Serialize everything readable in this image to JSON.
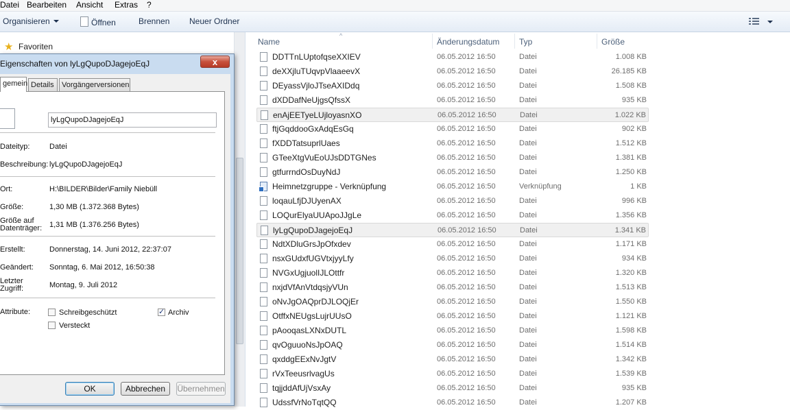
{
  "menubar": {
    "items": [
      "Datei",
      "Bearbeiten",
      "Ansicht",
      "Extras",
      "?"
    ]
  },
  "toolbar": {
    "organize": "Organisieren",
    "open": "Öffnen",
    "burn": "Brennen",
    "new_folder": "Neuer Ordner"
  },
  "nav": {
    "favorites": "Favoriten"
  },
  "columns": {
    "name": "Name",
    "date": "Änderungsdatum",
    "type": "Typ",
    "size": "Größe"
  },
  "files": [
    {
      "name": "DDTTnLUptofqseXXIEV",
      "date": "06.05.2012 16:50",
      "type": "Datei",
      "size": "1.008 KB"
    },
    {
      "name": "deXXjluTUqvpVlaaeevX",
      "date": "06.05.2012 16:50",
      "type": "Datei",
      "size": "26.185 KB"
    },
    {
      "name": "DEyassVjloJTseAXIDdq",
      "date": "06.05.2012 16:50",
      "type": "Datei",
      "size": "1.508 KB"
    },
    {
      "name": "dXDDafNeUjgsQfssX",
      "date": "06.05.2012 16:50",
      "type": "Datei",
      "size": "935 KB"
    },
    {
      "name": "enAjEETyeLUjloyasnXO",
      "date": "06.05.2012 16:50",
      "type": "Datei",
      "size": "1.022 KB"
    },
    {
      "name": "ftjGqddooGxAdqEsGq",
      "date": "06.05.2012 16:50",
      "type": "Datei",
      "size": "902 KB"
    },
    {
      "name": "fXDDTatsuprlUaes",
      "date": "06.05.2012 16:50",
      "type": "Datei",
      "size": "1.512 KB"
    },
    {
      "name": "GTeeXtgVuEoUJsDDTGNes",
      "date": "06.05.2012 16:50",
      "type": "Datei",
      "size": "1.381 KB"
    },
    {
      "name": "gtfurrndOsDuyNdJ",
      "date": "06.05.2012 16:50",
      "type": "Datei",
      "size": "1.250 KB"
    },
    {
      "name": "Heimnetzgruppe - Verknüpfung",
      "date": "06.05.2012 16:50",
      "type": "Verknüpfung",
      "size": "1 KB"
    },
    {
      "name": "loqauLfjDJUyenAX",
      "date": "06.05.2012 16:50",
      "type": "Datei",
      "size": "996 KB"
    },
    {
      "name": "LOQurElyaUUApoJJgLe",
      "date": "06.05.2012 16:50",
      "type": "Datei",
      "size": "1.356 KB"
    },
    {
      "name": "lyLgQupoDJagejoEqJ",
      "date": "06.05.2012 16:50",
      "type": "Datei",
      "size": "1.341 KB"
    },
    {
      "name": "NdtXDluGrsJpOfxdev",
      "date": "06.05.2012 16:50",
      "type": "Datei",
      "size": "1.171 KB"
    },
    {
      "name": "nsxGUdxfUGVtxjyyLfy",
      "date": "06.05.2012 16:50",
      "type": "Datei",
      "size": "934 KB"
    },
    {
      "name": "NVGxUgjuolIJLOttfr",
      "date": "06.05.2012 16:50",
      "type": "Datei",
      "size": "1.320 KB"
    },
    {
      "name": "nxjdVfAnVtdqsjyVUn",
      "date": "06.05.2012 16:50",
      "type": "Datei",
      "size": "1.513 KB"
    },
    {
      "name": "oNvJgOAQprDJLOQjEr",
      "date": "06.05.2012 16:50",
      "type": "Datei",
      "size": "1.550 KB"
    },
    {
      "name": "OtffxNEUgsLujrUUsO",
      "date": "06.05.2012 16:50",
      "type": "Datei",
      "size": "1.121 KB"
    },
    {
      "name": "pAooqasLXNxDUTL",
      "date": "06.05.2012 16:50",
      "type": "Datei",
      "size": "1.598 KB"
    },
    {
      "name": "qvOguuoNsJpOAQ",
      "date": "06.05.2012 16:50",
      "type": "Datei",
      "size": "1.514 KB"
    },
    {
      "name": "qxddgEExNvJgtV",
      "date": "06.05.2012 16:50",
      "type": "Datei",
      "size": "1.342 KB"
    },
    {
      "name": "rVxTeeusrlvagUs",
      "date": "06.05.2012 16:50",
      "type": "Datei",
      "size": "1.539 KB"
    },
    {
      "name": "tqjjddAfUjVsxAy",
      "date": "06.05.2012 16:50",
      "type": "Datei",
      "size": "935 KB"
    },
    {
      "name": "UdssfVrNoTqtQQ",
      "date": "06.05.2012 16:50",
      "type": "Datei",
      "size": "1.207 KB"
    }
  ],
  "dialog": {
    "title": "Eigenschaften von lyLgQupoDJagejoEqJ",
    "close": "x",
    "tabs": [
      "gemein",
      "Details",
      "Vorgängerversionen"
    ],
    "file_name": "lyLgQupoDJagejoEqJ",
    "props": {
      "type_label": "Dateityp:",
      "type_value": "Datei",
      "desc_label": "Beschreibung:",
      "desc_value": "lyLgQupoDJagejoEqJ",
      "loc_label": "Ort:",
      "loc_value": "H:\\BILDER\\Bilder\\Family Niebüll",
      "size_label": "Größe:",
      "size_value": "1,30 MB (1.372.368 Bytes)",
      "disk_label_1": "Größe auf",
      "disk_label_2": "Datenträger:",
      "disk_value": "1,31 MB (1.376.256 Bytes)",
      "created_label": "Erstellt:",
      "created_value": "Donnerstag, 14. Juni 2012, 22:37:07",
      "modified_label": "Geändert:",
      "modified_value": "Sonntag, 6. Mai 2012, 16:50:38",
      "access_label_1": "Letzter",
      "access_label_2": "Zugriff:",
      "access_value": "Montag, 9. Juli 2012",
      "attr_label": "Attribute:",
      "readonly": "Schreibgeschützt",
      "hidden": "Versteckt",
      "archive": "Archiv"
    },
    "buttons": {
      "ok": "OK",
      "cancel": "Abbrechen",
      "apply": "Übernehmen"
    }
  },
  "selected_row": "lyLgQupoDJagejoEqJ",
  "hover_row": "enAjEETyeLUjloyasnXO"
}
